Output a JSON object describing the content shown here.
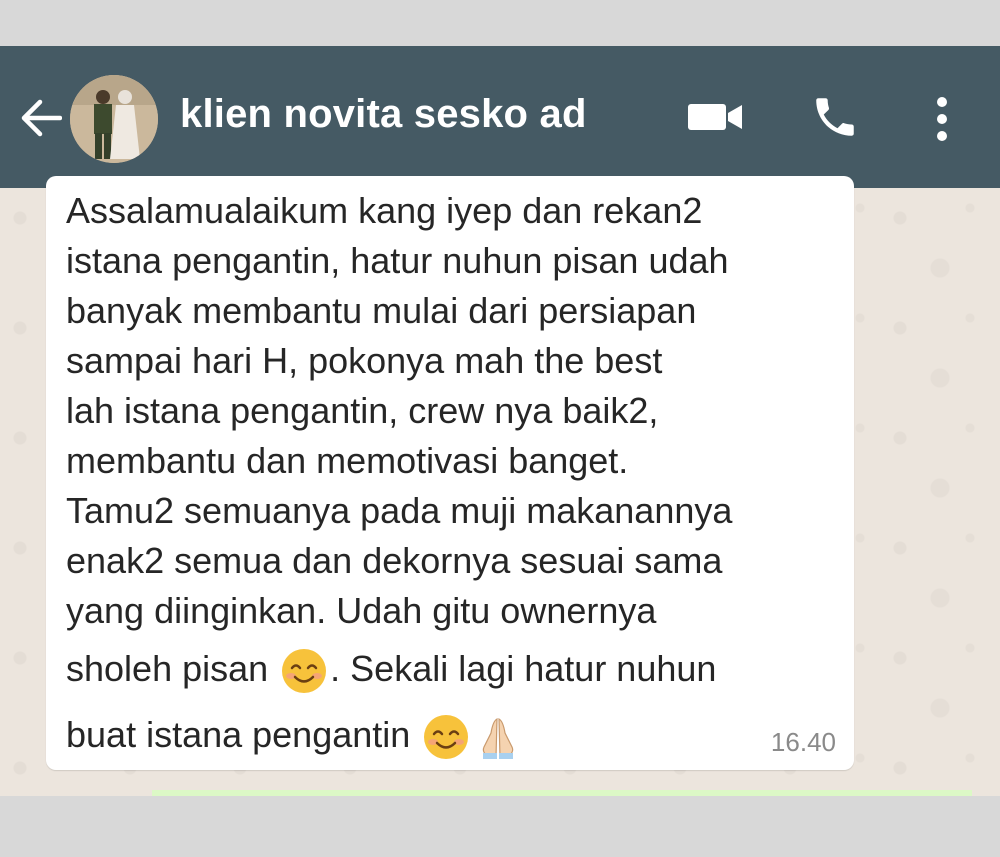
{
  "header": {
    "contact_name": "klien novita sesko ad",
    "color": "#455a64"
  },
  "message": {
    "lines": [
      "Assalamualaikum kang iyep dan rekan2",
      "istana pengantin, hatur nuhun pisan udah",
      "banyak membantu mulai dari persiapan",
      "sampai hari H, pokonya mah the best",
      "lah istana pengantin, crew nya baik2,",
      "membantu dan memotivasi banget.",
      "Tamu2 semuanya pada muji makanannya",
      "enak2 semua dan dekornya sesuai sama",
      "yang diinginkan. Udah gitu ownernya"
    ],
    "line10_before": "sholeh pisan ",
    "line10_after": ". Sekali lagi hatur nuhun",
    "line11": "buat istana pengantin ",
    "time": "16.40"
  },
  "icons": {
    "back": "arrow-left-icon",
    "video": "video-call-icon",
    "call": "phone-icon",
    "menu": "more-vert-icon",
    "smile": "smiling-face-emoji",
    "pray": "folded-hands-emoji"
  }
}
